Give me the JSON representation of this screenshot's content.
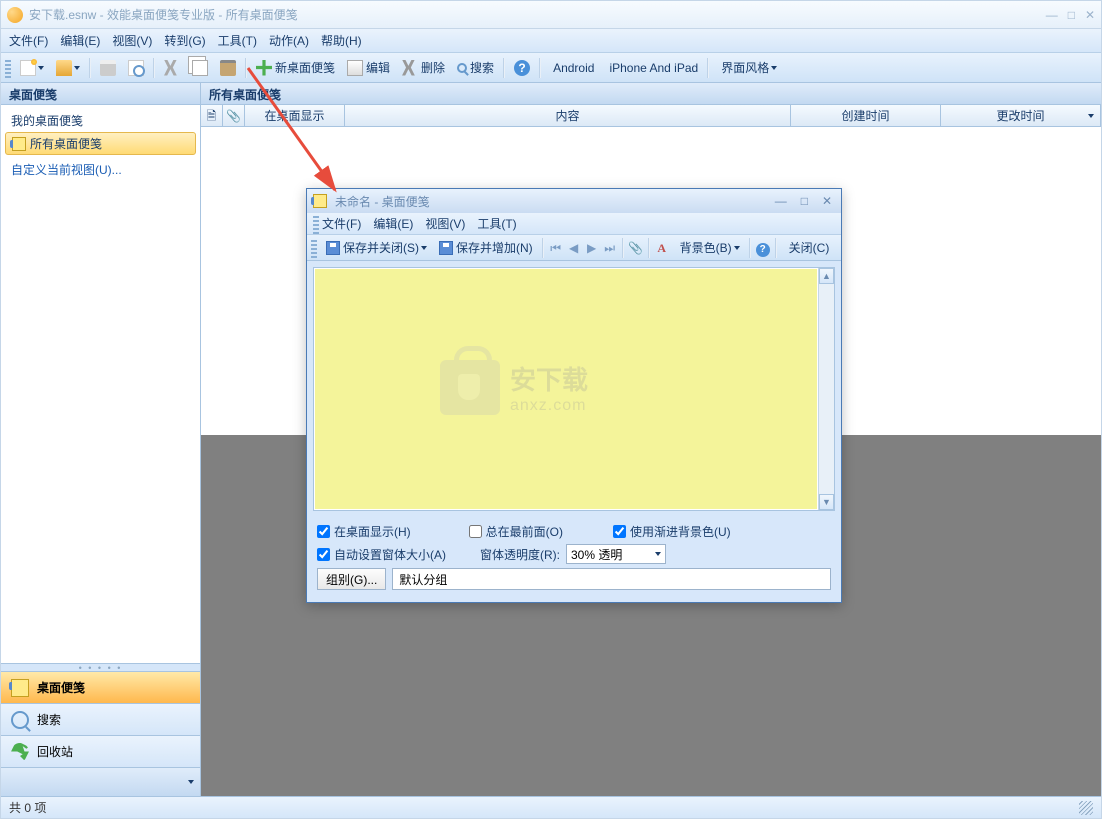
{
  "title": "安下载.esnw - 效能桌面便笺专业版 - 所有桌面便笺",
  "menu": [
    "文件(F)",
    "编辑(E)",
    "视图(V)",
    "转到(G)",
    "工具(T)",
    "动作(A)",
    "帮助(H)"
  ],
  "toolbar": {
    "new_note": "新桌面便笺",
    "edit": "编辑",
    "delete": "删除",
    "search": "搜索",
    "android": "Android",
    "iphone": "iPhone And iPad",
    "style": "界面风格"
  },
  "sidebar": {
    "head": "桌面便笺",
    "my_notes": "我的桌面便笺",
    "all_notes": "所有桌面便笺",
    "custom_view": "自定义当前视图(U)...",
    "nav1": "桌面便笺",
    "nav2": "搜索",
    "nav3": "回收站"
  },
  "grid": {
    "head": "所有桌面便笺",
    "cols": {
      "c1": "",
      "c2": "",
      "c3": "在桌面显示",
      "c4": "内容",
      "c5": "创建时间",
      "c6": "更改时间"
    }
  },
  "status": "共 0 项",
  "modal": {
    "title": "未命名 - 桌面便笺",
    "menu": [
      "文件(F)",
      "编辑(E)",
      "视图(V)",
      "工具(T)"
    ],
    "save_close": "保存并关闭(S)",
    "save_add": "保存并增加(N)",
    "bgcolor": "背景色(B)",
    "close": "关闭(C)",
    "opt_desktop": "在桌面显示(H)",
    "opt_top": "总在最前面(O)",
    "opt_gradient": "使用渐进背景色(U)",
    "opt_autosize": "自动设置窗体大小(A)",
    "opacity_label": "窗体透明度(R):",
    "opacity_value": "30% 透明",
    "group_btn": "组别(G)...",
    "group_value": "默认分组"
  },
  "watermark": {
    "t1": "安下载",
    "t2": "anxz.com"
  }
}
